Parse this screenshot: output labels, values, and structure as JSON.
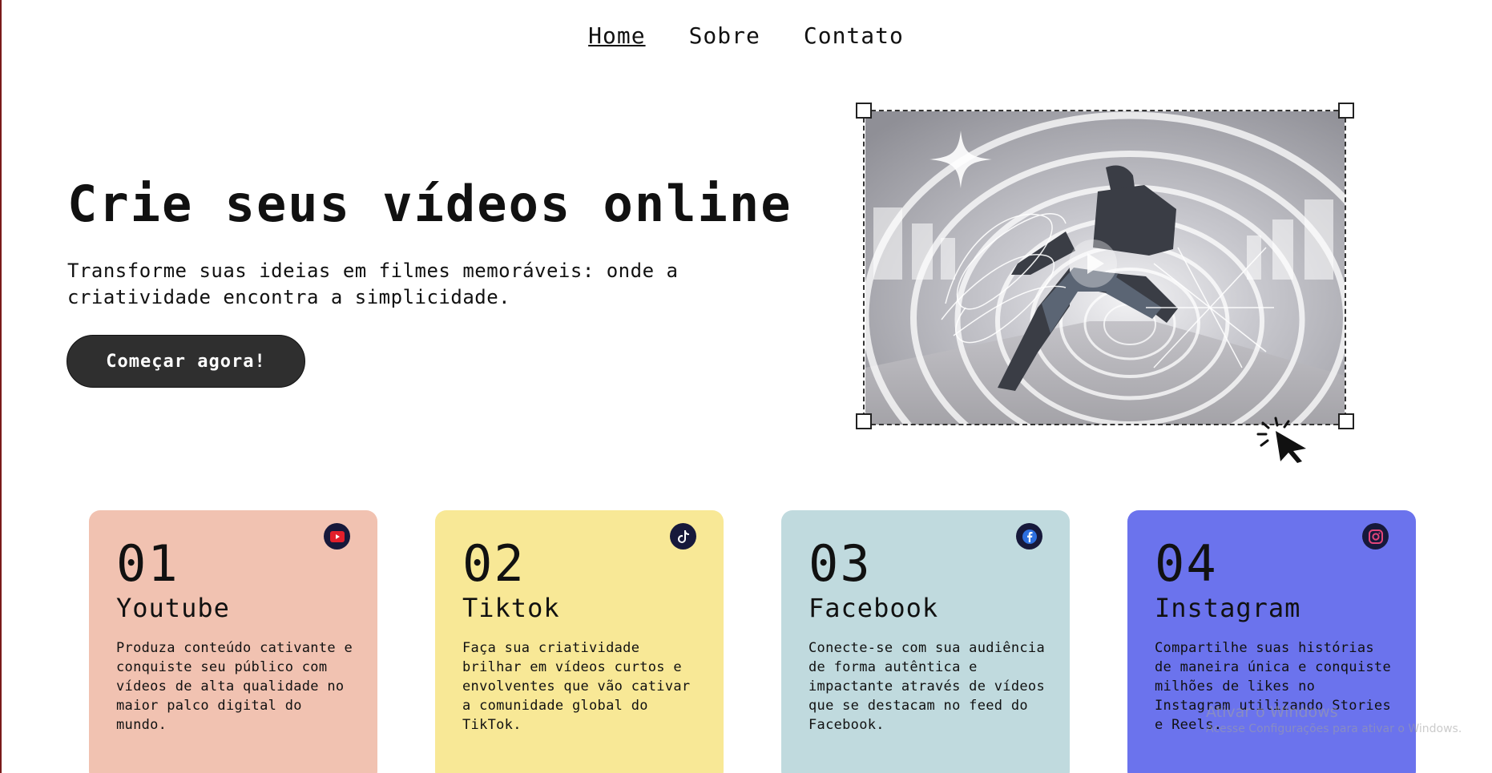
{
  "nav": {
    "items": [
      {
        "label": "Home",
        "active": true
      },
      {
        "label": "Sobre",
        "active": false
      },
      {
        "label": "Contato",
        "active": false
      }
    ]
  },
  "hero": {
    "title": "Crie seus vídeos online",
    "subtitle": "Transforme suas ideias em filmes memoráveis: onde a criatividade encontra a simplicidade.",
    "cta_label": "Começar agora!"
  },
  "media": {
    "icons": [
      "sparkle-icon",
      "play-icon",
      "cursor-click-icon"
    ]
  },
  "cards": [
    {
      "number": "01",
      "name": "Youtube",
      "description": "Produza conteúdo cativante e conquiste seu público com vídeos de alta qualidade no maior palco digital do mundo.",
      "color": "#f1c2b1",
      "icon": "youtube-icon"
    },
    {
      "number": "02",
      "name": "Tiktok",
      "description": "Faça sua criatividade brilhar em vídeos curtos e envolventes que vão cativar a comunidade global do TikTok.",
      "color": "#f8e896",
      "icon": "tiktok-icon"
    },
    {
      "number": "03",
      "name": "Facebook",
      "description": "Conecte-se com sua audiência de forma autêntica e impactante através de vídeos que se destacam no feed do Facebook.",
      "color": "#c0dade",
      "icon": "facebook-icon"
    },
    {
      "number": "04",
      "name": "Instagram",
      "description": "Compartilhe suas histórias de maneira única e conquiste milhões de likes no Instagram utilizando Stories e Reels.",
      "color": "#6b73ed",
      "icon": "instagram-icon"
    }
  ],
  "watermark": {
    "line1": "Ativar o Windows",
    "line2": "Acesse Configurações para ativar o Windows."
  },
  "colors": {
    "button_bg": "#2f2f2f",
    "text": "#111111",
    "social_icon_bg": "#17193b"
  }
}
